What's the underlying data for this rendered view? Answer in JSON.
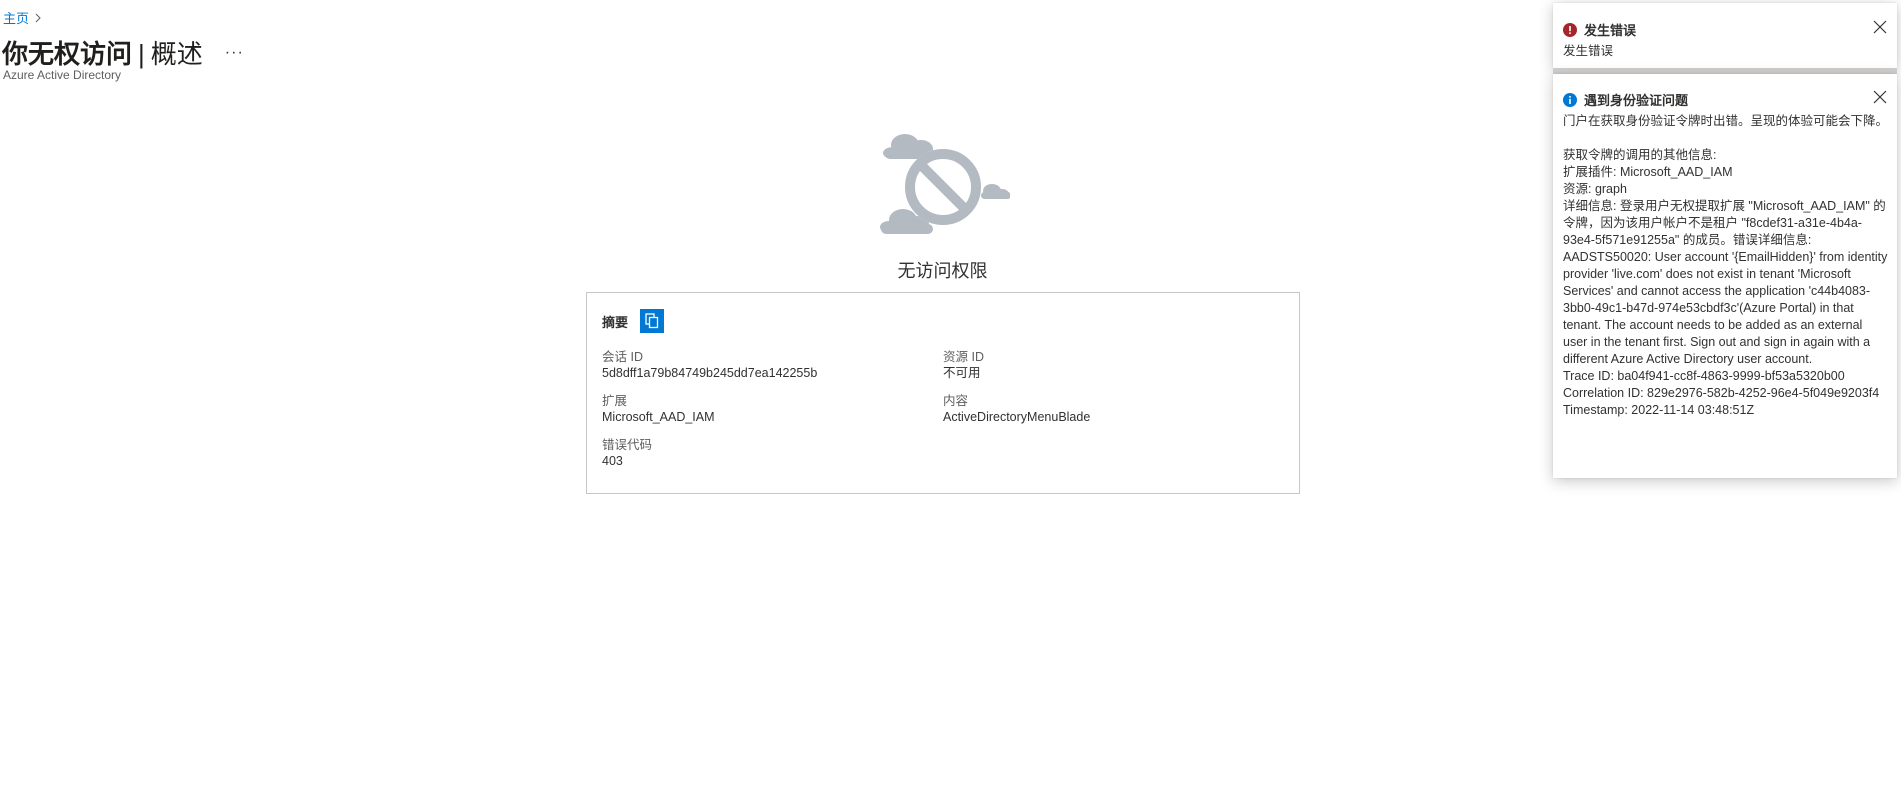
{
  "breadcrumb": {
    "home": "主页"
  },
  "header": {
    "title": "你无权访问",
    "separator": "|",
    "section": "概述",
    "more": "···",
    "subtitle": "Azure Active Directory"
  },
  "main": {
    "illustration": "no-access-cloud-icon",
    "heading": "无访问权限",
    "summary": {
      "title": "摘要",
      "copy_icon": "copy-icon",
      "fields": [
        {
          "label": "会话 ID",
          "value": "5d8dff1a79b84749b245dd7ea142255b"
        },
        {
          "label": "资源 ID",
          "value": "不可用"
        },
        {
          "label": "扩展",
          "value": "Microsoft_AAD_IAM"
        },
        {
          "label": "内容",
          "value": "ActiveDirectoryMenuBlade"
        },
        {
          "label": "错误代码",
          "value": "403"
        }
      ]
    }
  },
  "notifications": [
    {
      "type": "error",
      "icon": "error-icon",
      "title": "发生错误",
      "body": "发生错误"
    },
    {
      "type": "info",
      "icon": "info-icon",
      "title": "遇到身份验证问题",
      "body": "门户在获取身份验证令牌时出错。呈现的体验可能会下降。\n\n获取令牌的调用的其他信息:\n扩展插件: Microsoft_AAD_IAM\n资源: graph\n详细信息: 登录用户无权提取扩展 \"Microsoft_AAD_IAM\" 的令牌，因为该用户帐户不是租户 \"f8cdef31-a31e-4b4a-93e4-5f571e91255a\" 的成员。错误详细信息: AADSTS50020: User account '{EmailHidden}' from identity provider 'live.com' does not exist in tenant 'Microsoft Services' and cannot access the application 'c44b4083-3bb0-49c1-b47d-974e53cbdf3c'(Azure Portal) in that tenant. The account needs to be added as an external user in the tenant first. Sign out and sign in again with a different Azure Active Directory user account.\nTrace ID: ba04f941-cc8f-4863-9999-bf53a5320b00\nCorrelation ID: 829e2976-582b-4252-96e4-5f049e9203f4\nTimestamp: 2022-11-14 03:48:51Z"
    }
  ],
  "colors": {
    "accent": "#0078d4",
    "error": "#a4262c",
    "info": "#0078d4",
    "illustration": "#b4bac2"
  }
}
